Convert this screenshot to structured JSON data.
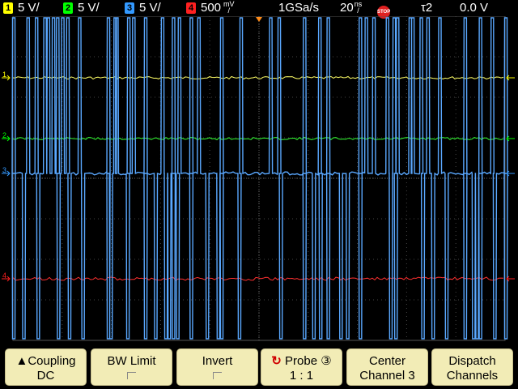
{
  "status": {
    "ch1": {
      "num": "1",
      "scale": "5 V/",
      "color": "#ffff00"
    },
    "ch2": {
      "num": "2",
      "scale": "5 V/",
      "color": "#00ff00"
    },
    "ch3": {
      "num": "3",
      "scale": "5 V/",
      "color": "#3399ff"
    },
    "ch4": {
      "num": "4",
      "scale": "500",
      "unit_top": "mV",
      "unit_bot": "/",
      "color": "#ff2020"
    },
    "samplerate": "1GSa/s",
    "timebase": "20",
    "timebase_unit_top": "ns",
    "timebase_unit_bot": "/",
    "run_state": "STOP",
    "trigger_source": "τ2",
    "trigger_level": "0.0 V"
  },
  "traces": {
    "ch1_color": "#ffff66",
    "ch2_color": "#33ff33",
    "ch3_color": "#5aa8ff",
    "ch4_color": "#ff3030",
    "ch3_pulse_high_x": [
      16,
      33,
      43,
      53,
      57,
      63,
      68,
      74,
      80,
      94,
      128,
      136,
      138,
      152,
      158,
      172,
      192,
      205,
      212,
      226,
      235,
      262,
      285,
      320,
      330,
      360,
      378,
      388,
      426,
      433,
      442,
      458,
      466,
      470,
      485,
      488,
      498,
      506,
      520,
      550,
      568,
      582,
      598
    ],
    "ch3_pulse_low_x": [
      16,
      28,
      45,
      69,
      82,
      98,
      128,
      131,
      151,
      172,
      184,
      196,
      200,
      205,
      210,
      226,
      245,
      258,
      262,
      283,
      332,
      360,
      371,
      379,
      388,
      403,
      411,
      426,
      462,
      468,
      500,
      512,
      528,
      550,
      560,
      564,
      568,
      585,
      598
    ]
  },
  "markers": {
    "ch1": "1",
    "ch2": "2",
    "ch3": "3",
    "ch4": "4",
    "trigger_pos": "T"
  },
  "softkeys": [
    {
      "line1": "▲Coupling",
      "line2": "DC",
      "icon": ""
    },
    {
      "line1": "BW Limit",
      "line2": "",
      "icon": "toggle"
    },
    {
      "line1": "Invert",
      "line2": "",
      "icon": "toggle"
    },
    {
      "line1": "Probe ③",
      "line2": "1 : 1",
      "icon": "rotate-icon"
    },
    {
      "line1": "Center",
      "line2": "Channel 3",
      "icon": ""
    },
    {
      "line1": "Dispatch",
      "line2": "Channels",
      "icon": ""
    }
  ]
}
